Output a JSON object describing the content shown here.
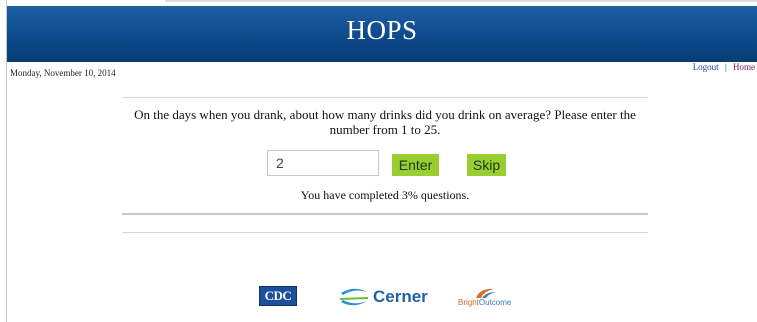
{
  "header": {
    "title": "HOPS"
  },
  "date": "Monday, November 10, 2014",
  "nav": {
    "logout": "Logout",
    "separator": "|",
    "home": "Home"
  },
  "question": {
    "text": "On the days when you drank, about how many drinks did you drink on average? Please enter the number from 1 to 25.",
    "answer_value": "2",
    "enter_label": "Enter",
    "skip_label": "Skip"
  },
  "progress_text": "You have completed 3% questions.",
  "logos": {
    "cdc": "CDC",
    "cerner": "Cerner",
    "bright_prefix": "Bright",
    "bright_suffix": "Outcome"
  },
  "colors": {
    "header": "#0d4a8c",
    "button": "#9acd32",
    "link": "#1a3f9e"
  }
}
